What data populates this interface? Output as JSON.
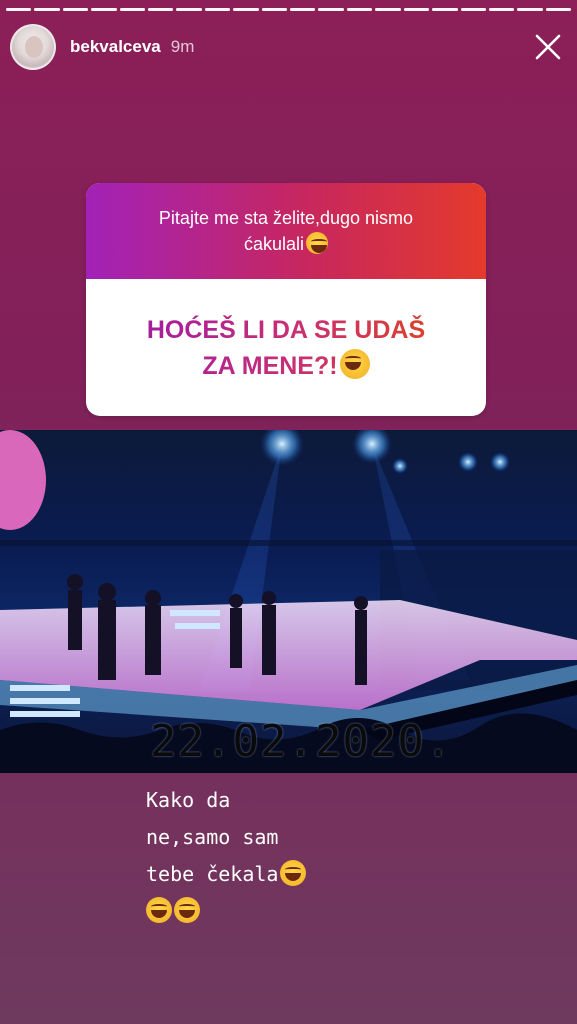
{
  "story": {
    "segments": 20,
    "progress": 1.0
  },
  "header": {
    "username": "bekvalceva",
    "time": "9m",
    "close_icon": "close-icon",
    "avatar_icon": "avatar"
  },
  "sticker": {
    "prompt_line1": "Pitajte me sta želite,dugo nismo",
    "prompt_line2": "ćakulali",
    "answer_line1": "HOĆEŠ LI DA SE UDAŠ",
    "answer_line2": "ZA MENE?!"
  },
  "photo": {
    "date": "22.02.2020."
  },
  "caption": {
    "line1": "Kako da",
    "line2": "ne,samo sam",
    "line3": "tebe čekala",
    "emoji_name": "laughing-tears-emoji"
  },
  "colors": {
    "background_top": "#8c1f58",
    "background_bottom": "#6e3a5e",
    "sticker_gradient_start": "#a222b8",
    "sticker_gradient_end": "#e43a2c"
  }
}
